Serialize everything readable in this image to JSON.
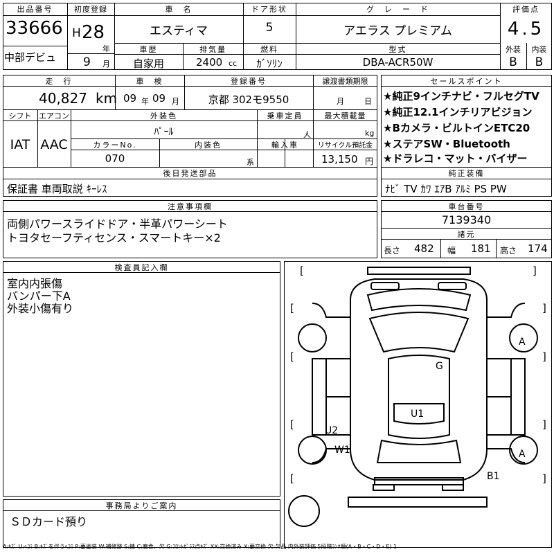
{
  "top": {
    "lot_no_label": "出品番号",
    "lot_no": "33666",
    "first_reg_label": "初度登録",
    "era": "H",
    "year": "28",
    "year_unit": "年",
    "month": "9",
    "month_unit": "月",
    "name_label": "車　名",
    "name": "エスティマ",
    "doors_label": "ドア形状",
    "doors": "5",
    "grade_label": "グ　レ　ー　ド",
    "grade": "アエラス プレミアム",
    "score_label": "評価点",
    "score": "4.5",
    "debut": "中部デビュ",
    "history_label": "車歴",
    "history": "自家用",
    "displacement_label": "排気量",
    "displacement": "2400",
    "cc": "cc",
    "fuel_label": "燃料",
    "fuel": "ｶﾞｿﾘﾝ",
    "model_label": "型式",
    "model": "DBA-ACR50W",
    "ext_label": "外装",
    "int_label": "内装",
    "ext": "B",
    "int": "B"
  },
  "row2": {
    "mileage_label": "走　行",
    "mileage": "40,827",
    "km": "km",
    "inspection_label": "車　検",
    "insp_year": "09",
    "insp_year_unit": "年",
    "insp_month": "09",
    "insp_month_unit": "月",
    "plate_label": "登録番号",
    "plate": "京都 302モ9550",
    "transfer_label": "譲渡書類期限",
    "transfer_m": "月",
    "transfer_d": "日",
    "shift_label": "シフト",
    "shift": "IAT",
    "ac_label": "エアコン",
    "ac": "AAC",
    "color_label": "外装色",
    "color": "ﾊﾟｰﾙ",
    "capacity_label": "乗車定員",
    "capacity_unit": "人",
    "load_label": "最大積載量",
    "load_unit": "kg",
    "color_no_label": "カラーNo.",
    "color_no": "070",
    "int_color_label": "内装色",
    "int_color_unit": "系",
    "import_label": "輸入車",
    "recycle_label": "リサイクル預託金",
    "recycle": "13,150",
    "yen": "円",
    "later_label": "後日発送部品",
    "later": "保証書 車両取説 ｷｰﾚｽ"
  },
  "sales": {
    "label": "セールスポイント",
    "items": [
      "★純正9インチナビ・フルセグTV",
      "★純正12.1インチリアビジョン",
      "★Bカメラ・ビルトインETC20",
      "★ステアSW・Bluetooth",
      "★ドラレコ・マット・バイザー"
    ],
    "equip_label": "純正装備",
    "equip": "ﾅﾋﾞ TV ｶﾜ ｴｱB ｱﾙﾐ PS PW"
  },
  "notes": {
    "label": "注意事項欄",
    "lines": [
      "両側パワースライドドア・半革パワーシート",
      "トヨタセーフティセンス・スマートキー×2"
    ]
  },
  "chassis": {
    "label": "車台番号",
    "number": "7139340",
    "dims_label": "諸元",
    "len_label": "長さ",
    "len": "482",
    "wid_label": "幅",
    "wid": "181",
    "hei_label": "高さ",
    "hei": "174"
  },
  "inspector": {
    "label": "検査員記入欄",
    "lines": [
      "室内内張傷",
      "バンパー下A",
      "外装小傷有り"
    ]
  },
  "office": {
    "label": "事務局よりご案内",
    "text": "ＳＤカード預り"
  },
  "diagram": {
    "marks": [
      "A",
      "G",
      "U1",
      "U2",
      "W1",
      "A",
      "B1"
    ]
  },
  "legend": "A:ｷｽﾞ U:ﾍｺﾐ B:ｷｽﾞを伴うﾍｺﾐ P:要塗装 W:補修跡 S:錆 C:腐食、欠 G:ﾌﾛﾝﾄｶﾞﾗｽ点ｷｽﾞ XX:交換済み X:要交換 欠:欠品 内外装評価 5段階ﾗﾝｸ順(A・B・C・D・E) 1"
}
